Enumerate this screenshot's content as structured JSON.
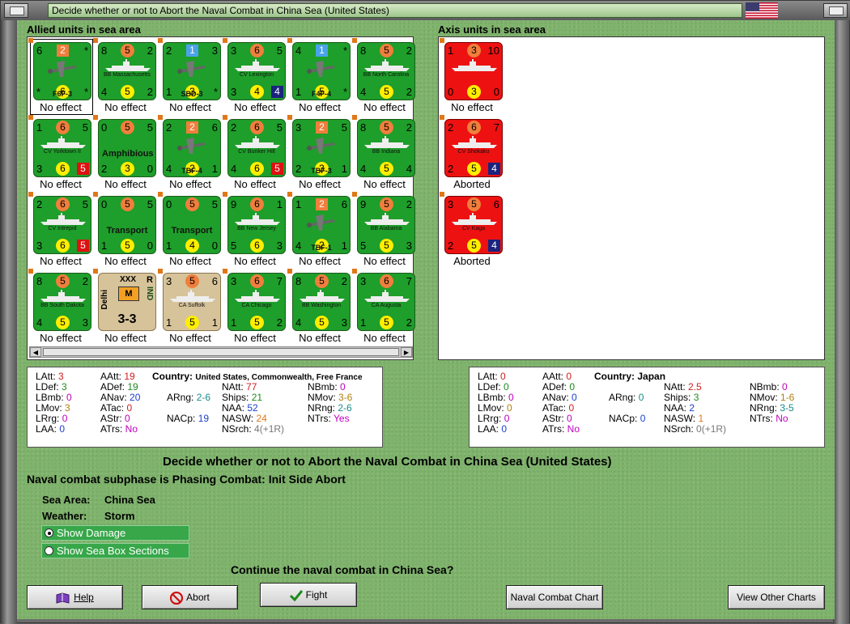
{
  "window": {
    "title": "Decide whether or not to Abort the Naval Combat in China Sea (United States)",
    "flag_icon": "us-flag-icon"
  },
  "allied": {
    "heading": "Allied units in sea area",
    "units": [
      {
        "kind": "air",
        "counter": {
          "tl": "6",
          "top": "2",
          "tr": "*",
          "bl": "*",
          "br": "*",
          "bot": "6",
          "name": "F6F-3"
        },
        "status": "No effect",
        "selected": true
      },
      {
        "kind": "ship",
        "counter": {
          "tl": "8",
          "top": "5",
          "tr": "2",
          "bl": "4",
          "br": "2",
          "bot": "5",
          "name": "BB Massachusetts"
        },
        "status": "No effect"
      },
      {
        "kind": "air",
        "counter": {
          "tl": "2",
          "top": "1",
          "tr": "3",
          "bl": "1",
          "br": "*",
          "bot": "3",
          "name": "SBD-3"
        },
        "status": "No effect"
      },
      {
        "kind": "ship",
        "counter": {
          "tl": "3",
          "top": "6",
          "tr": "5",
          "bl": "3",
          "br": "4",
          "bot": "4",
          "name": "CV Lexington"
        },
        "status": "No effect"
      },
      {
        "kind": "air",
        "counter": {
          "tl": "4",
          "top": "1",
          "tr": "*",
          "bl": "1",
          "br": "*",
          "bot": "5",
          "name": "F4F-4"
        },
        "status": "No effect"
      },
      {
        "kind": "ship",
        "counter": {
          "tl": "8",
          "top": "5",
          "tr": "2",
          "bl": "4",
          "br": "2",
          "bot": "5",
          "name": "BB North Carolina"
        },
        "status": "No effect"
      },
      {
        "kind": "ship",
        "counter": {
          "tl": "1",
          "top": "6",
          "tr": "5",
          "bl": "3",
          "br": "5",
          "bot": "6",
          "name": "CV Yorktown II"
        },
        "status": "No effect"
      },
      {
        "kind": "ship",
        "counter": {
          "tl": "0",
          "top": "5",
          "tr": "5",
          "bl": "2",
          "br": "0",
          "bot": "3",
          "name": "Amphibious"
        },
        "status": "No effect"
      },
      {
        "kind": "air",
        "counter": {
          "tl": "2",
          "top": "2",
          "tr": "6",
          "bl": "4",
          "br": "1",
          "bot": "2",
          "name": "TBF-4"
        },
        "status": "No effect"
      },
      {
        "kind": "ship",
        "counter": {
          "tl": "2",
          "top": "6",
          "tr": "5",
          "bl": "4",
          "br": "5",
          "bot": "6",
          "name": "CV Bunker Hill"
        },
        "status": "No effect"
      },
      {
        "kind": "air",
        "counter": {
          "tl": "3",
          "top": "2",
          "tr": "5",
          "bl": "2",
          "br": "1",
          "bot": "3",
          "name": "TBF-3"
        },
        "status": "No effect"
      },
      {
        "kind": "ship",
        "counter": {
          "tl": "8",
          "top": "5",
          "tr": "2",
          "bl": "4",
          "br": "4",
          "bot": "5",
          "name": "BB Indiana"
        },
        "status": "No effect"
      },
      {
        "kind": "ship",
        "counter": {
          "tl": "2",
          "top": "6",
          "tr": "5",
          "bl": "3",
          "br": "5",
          "bot": "6",
          "name": "CV Intrepid"
        },
        "status": "No effect"
      },
      {
        "kind": "ship",
        "counter": {
          "tl": "0",
          "top": "5",
          "tr": "5",
          "bl": "1",
          "br": "0",
          "bot": "5",
          "name": "Transport"
        },
        "status": "No effect"
      },
      {
        "kind": "ship",
        "counter": {
          "tl": "0",
          "top": "5",
          "tr": "5",
          "bl": "1",
          "br": "0",
          "bot": "4",
          "name": "Transport"
        },
        "status": "No effect"
      },
      {
        "kind": "ship",
        "counter": {
          "tl": "9",
          "top": "6",
          "tr": "1",
          "bl": "5",
          "br": "3",
          "bot": "6",
          "name": "BB New Jersey"
        },
        "status": "No effect"
      },
      {
        "kind": "air",
        "counter": {
          "tl": "1",
          "top": "2",
          "tr": "6",
          "bl": "4",
          "br": "1",
          "bot": "2",
          "name": "TBF-1"
        },
        "status": "No effect"
      },
      {
        "kind": "ship",
        "counter": {
          "tl": "9",
          "top": "5",
          "tr": "2",
          "bl": "5",
          "br": "3",
          "bot": "5",
          "name": "BB Alabama"
        },
        "status": "No effect"
      },
      {
        "kind": "ship",
        "counter": {
          "tl": "8",
          "top": "5",
          "tr": "2",
          "bl": "4",
          "br": "3",
          "bot": "5",
          "name": "BB South Dakota"
        },
        "status": "No effect"
      },
      {
        "kind": "army",
        "counter": {
          "xxx": "XXX",
          "r": "R",
          "side_left": "Delhi",
          "side_right": "IND",
          "box": "M",
          "strength": "3-3"
        },
        "status": "No effect"
      },
      {
        "kind": "ship",
        "color": "india",
        "counter": {
          "tl": "3",
          "top": "5",
          "tr": "6",
          "bl": "1",
          "br": "1",
          "bot": "5",
          "name": "CA Suffolk"
        },
        "status": "No effect"
      },
      {
        "kind": "ship",
        "counter": {
          "tl": "3",
          "top": "6",
          "tr": "7",
          "bl": "1",
          "br": "2",
          "bot": "5",
          "name": "CA Chicago"
        },
        "status": "No effect"
      },
      {
        "kind": "ship",
        "counter": {
          "tl": "8",
          "top": "5",
          "tr": "2",
          "bl": "4",
          "br": "3",
          "bot": "5",
          "name": "BB Washington"
        },
        "status": "No effect"
      },
      {
        "kind": "ship",
        "counter": {
          "tl": "3",
          "top": "6",
          "tr": "7",
          "bl": "1",
          "br": "2",
          "bot": "5",
          "name": "CA Augusta"
        },
        "status": "No effect"
      }
    ]
  },
  "axis": {
    "heading": "Axis units in sea area",
    "units": [
      {
        "kind": "ship",
        "counter": {
          "tl": "1",
          "top": "3",
          "tr": "10",
          "bl": "0",
          "br": "0",
          "bot": "3",
          "name": ""
        },
        "status": "No effect"
      },
      {
        "kind": "ship",
        "counter": {
          "tl": "2",
          "top": "6",
          "tr": "7",
          "bl": "2",
          "br": "4",
          "bot": "5",
          "name": "CV Shokaku"
        },
        "status": "Aborted"
      },
      {
        "kind": "ship",
        "counter": {
          "tl": "3",
          "top": "5",
          "tr": "6",
          "bl": "2",
          "br": "4",
          "bot": "5",
          "name": "CV Kaga"
        },
        "status": "Aborted"
      }
    ]
  },
  "allied_stats": {
    "country_label": "Country:",
    "country_value": "United States, Commonwealth, Free France",
    "items": [
      {
        "label": "LAtt:",
        "value": "3",
        "color": "#d21c1c"
      },
      {
        "label": "LDef:",
        "value": "3",
        "color": "#1e8a1e"
      },
      {
        "label": "LBmb:",
        "value": "0",
        "color": "#c000c0"
      },
      {
        "label": "LMov:",
        "value": "3",
        "color": "#b08010"
      },
      {
        "label": "LRrg:",
        "value": "0",
        "color": "#c000c0"
      },
      {
        "label": "LAA:",
        "value": "0",
        "color": "#1a3fd0"
      },
      {
        "label": "AAtt:",
        "value": "19",
        "color": "#d21c1c"
      },
      {
        "label": "ADef:",
        "value": "19",
        "color": "#1e8a1e"
      },
      {
        "label": "ANav:",
        "value": "20",
        "color": "#1a3fd0"
      },
      {
        "label": "ATac:",
        "value": "0",
        "color": "#d21c1c"
      },
      {
        "label": "AStr:",
        "value": "0",
        "color": "#c000c0"
      },
      {
        "label": "ATrs:",
        "value": "No",
        "color": "#c000c0"
      },
      {
        "label": "ARng:",
        "value": "2-6",
        "color": "#1a8a8a"
      },
      {
        "label": "NACp:",
        "value": "19",
        "color": "#1a3fd0"
      },
      {
        "label": "NAtt:",
        "value": "77",
        "color": "#d21c1c"
      },
      {
        "label": "Ships:",
        "value": "21",
        "color": "#1e8a1e"
      },
      {
        "label": "NAA:",
        "value": "52",
        "color": "#1a3fd0"
      },
      {
        "label": "NASW:",
        "value": "24",
        "color": "#e07818"
      },
      {
        "label": "NSrch:",
        "value": "4(+1R)",
        "color": "#777777"
      },
      {
        "label": "NBmb:",
        "value": "0",
        "color": "#c000c0"
      },
      {
        "label": "NMov:",
        "value": "3-6",
        "color": "#b08010"
      },
      {
        "label": "NRng:",
        "value": "2-6",
        "color": "#1a8a8a"
      },
      {
        "label": "NTrs:",
        "value": "Yes",
        "color": "#c000c0"
      }
    ]
  },
  "axis_stats": {
    "country_label": "Country:",
    "country_value": "Japan",
    "items": [
      {
        "label": "LAtt:",
        "value": "0",
        "color": "#d21c1c"
      },
      {
        "label": "LDef:",
        "value": "0",
        "color": "#1e8a1e"
      },
      {
        "label": "LBmb:",
        "value": "0",
        "color": "#c000c0"
      },
      {
        "label": "LMov:",
        "value": "0",
        "color": "#b08010"
      },
      {
        "label": "LRrg:",
        "value": "0",
        "color": "#c000c0"
      },
      {
        "label": "LAA:",
        "value": "0",
        "color": "#1a3fd0"
      },
      {
        "label": "AAtt:",
        "value": "0",
        "color": "#d21c1c"
      },
      {
        "label": "ADef:",
        "value": "0",
        "color": "#1e8a1e"
      },
      {
        "label": "ANav:",
        "value": "0",
        "color": "#1a3fd0"
      },
      {
        "label": "ATac:",
        "value": "0",
        "color": "#d21c1c"
      },
      {
        "label": "AStr:",
        "value": "0",
        "color": "#c000c0"
      },
      {
        "label": "ATrs:",
        "value": "No",
        "color": "#c000c0"
      },
      {
        "label": "ARng:",
        "value": "0",
        "color": "#1a8a8a"
      },
      {
        "label": "NACp:",
        "value": "0",
        "color": "#1a3fd0"
      },
      {
        "label": "NAtt:",
        "value": "2.5",
        "color": "#d21c1c"
      },
      {
        "label": "Ships:",
        "value": "3",
        "color": "#1e8a1e"
      },
      {
        "label": "NAA:",
        "value": "2",
        "color": "#1a3fd0"
      },
      {
        "label": "NASW:",
        "value": "1",
        "color": "#e07818"
      },
      {
        "label": "NSrch:",
        "value": "0(+1R)",
        "color": "#777777"
      },
      {
        "label": "NBmb:",
        "value": "0",
        "color": "#c000c0"
      },
      {
        "label": "NMov:",
        "value": "1-6",
        "color": "#b08010"
      },
      {
        "label": "NRng:",
        "value": "3-5",
        "color": "#1a8a8a"
      },
      {
        "label": "NTrs:",
        "value": "No",
        "color": "#c000c0"
      }
    ]
  },
  "info": {
    "headline": "Decide whether or not to Abort the Naval Combat in China Sea (United States)",
    "subphase": "Naval combat subphase is Phasing Combat: Init Side Abort",
    "sea_area_label": "Sea Area:",
    "sea_area_value": "China Sea",
    "weather_label": "Weather:",
    "weather_value": "Storm",
    "show_damage": "Show Damage",
    "show_sea_box": "Show Sea Box Sections",
    "question": "Continue the naval combat in China Sea?"
  },
  "buttons": {
    "help": "Help",
    "abort": "Abort",
    "fight": "Fight",
    "naval_chart": "Naval Combat Chart",
    "other_charts": "View Other Charts"
  }
}
